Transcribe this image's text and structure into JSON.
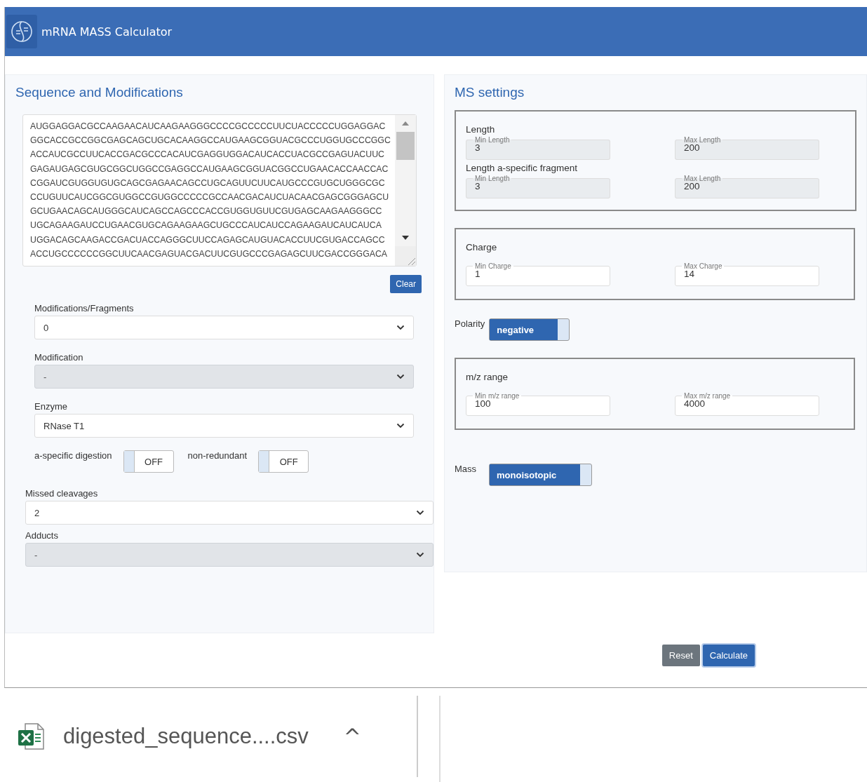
{
  "app": {
    "title": "mRNA MASS Calculator"
  },
  "sequence_panel": {
    "title": "Sequence and Modifications",
    "sequence_lines": [
      "AUGGAGGACGCCAAGAACAUCAAGAAGGGCCCCGCCCCCUUCUACCCCCUGGAGGAC",
      "GGCACCGCCGGCGAGCAGCUGCACAAGGCCAUGAAGCGGUACGCCCUGGUGCCCGGC",
      "ACCAUCGCCUUCACCGACGCCCACAUCGAGGUGGACAUCACCUACGCCGAGUACUUC",
      "GAGAUGAGCGUGCGGCUGGCCGAGGCCAUGAAGCGGUACGGCCUGAACACCAACCAC",
      "CGGAUCGUGGUGUGCAGCGAGAACAGCCUGCAGUUCUUCAUGCCCGUGCUGGGCGC",
      "CCUGUUCAUCGGCGUGGCCGUGGCCCCCGCCAACGACAUCUACAACGAGCGGGAGCU",
      "GCUGAACAGCAUGGGCAUCAGCCAGCCCACCGUGGUGUUCGUGAGCAAGAAGGGCC",
      "UGCAGAAGAUCCUGAACGUGCAGAAGAAGCUGCCCAUCAUCCAGAAGAUCAUCAUCA",
      "UGGACAGCAAGACCGACUACCAGGGCUUCCAGAGCAUGUACACCUUCGUGACCAGCC",
      "ACCUGCCCCCCGGCUUCAACGAGUACGACUUCGUGCCCGAGAGCUUCGACCGGGACA"
    ],
    "clear_button": "Clear",
    "selects_top": [
      {
        "label": "Modifications/Fragments",
        "value": "0",
        "disabled": false
      },
      {
        "label": "Modification",
        "value": "-",
        "disabled": true
      },
      {
        "label": "Enzyme",
        "value": "RNase T1",
        "disabled": false
      }
    ],
    "toggles": [
      {
        "label": "a-specific digestion",
        "state_label": "OFF",
        "on": false
      },
      {
        "label": "non-redundant",
        "state_label": "OFF",
        "on": false
      }
    ],
    "selects_bottom": [
      {
        "label": "Missed cleavages",
        "value": "2",
        "disabled": false
      },
      {
        "label": "Adducts",
        "value": "-",
        "disabled": true
      }
    ]
  },
  "ms_panel": {
    "title": "MS settings",
    "length_group": {
      "rows": [
        {
          "title": "Length",
          "fields": [
            {
              "label": "Min Length",
              "value": "3",
              "disabled": true
            },
            {
              "label": "Max Length",
              "value": "200",
              "disabled": true
            }
          ]
        },
        {
          "title": "Length a-specific fragment",
          "fields": [
            {
              "label": "Min Length",
              "value": "3",
              "disabled": true
            },
            {
              "label": "Max Length",
              "value": "200",
              "disabled": true
            }
          ]
        }
      ]
    },
    "charge_group": {
      "title": "Charge",
      "fields": [
        {
          "label": "Min Charge",
          "value": "1",
          "disabled": false
        },
        {
          "label": "Max Charge",
          "value": "14",
          "disabled": false
        }
      ]
    },
    "polarity": {
      "label": "Polarity",
      "state_label": "negative",
      "on": true
    },
    "mz_group": {
      "title": "m/z range",
      "fields": [
        {
          "label": "Min m/z range",
          "value": "100",
          "disabled": false
        },
        {
          "label": "Max m/z range",
          "value": "4000",
          "disabled": false
        }
      ]
    },
    "mass": {
      "label": "Mass",
      "state_label": "monoisotopic",
      "on": true
    }
  },
  "buttons": [
    {
      "label": "Reset",
      "kind": "secondary"
    },
    {
      "label": "Calculate",
      "kind": "primary"
    }
  ],
  "download_bar": {
    "file_name": "digested_sequence....csv",
    "caret": "^"
  }
}
